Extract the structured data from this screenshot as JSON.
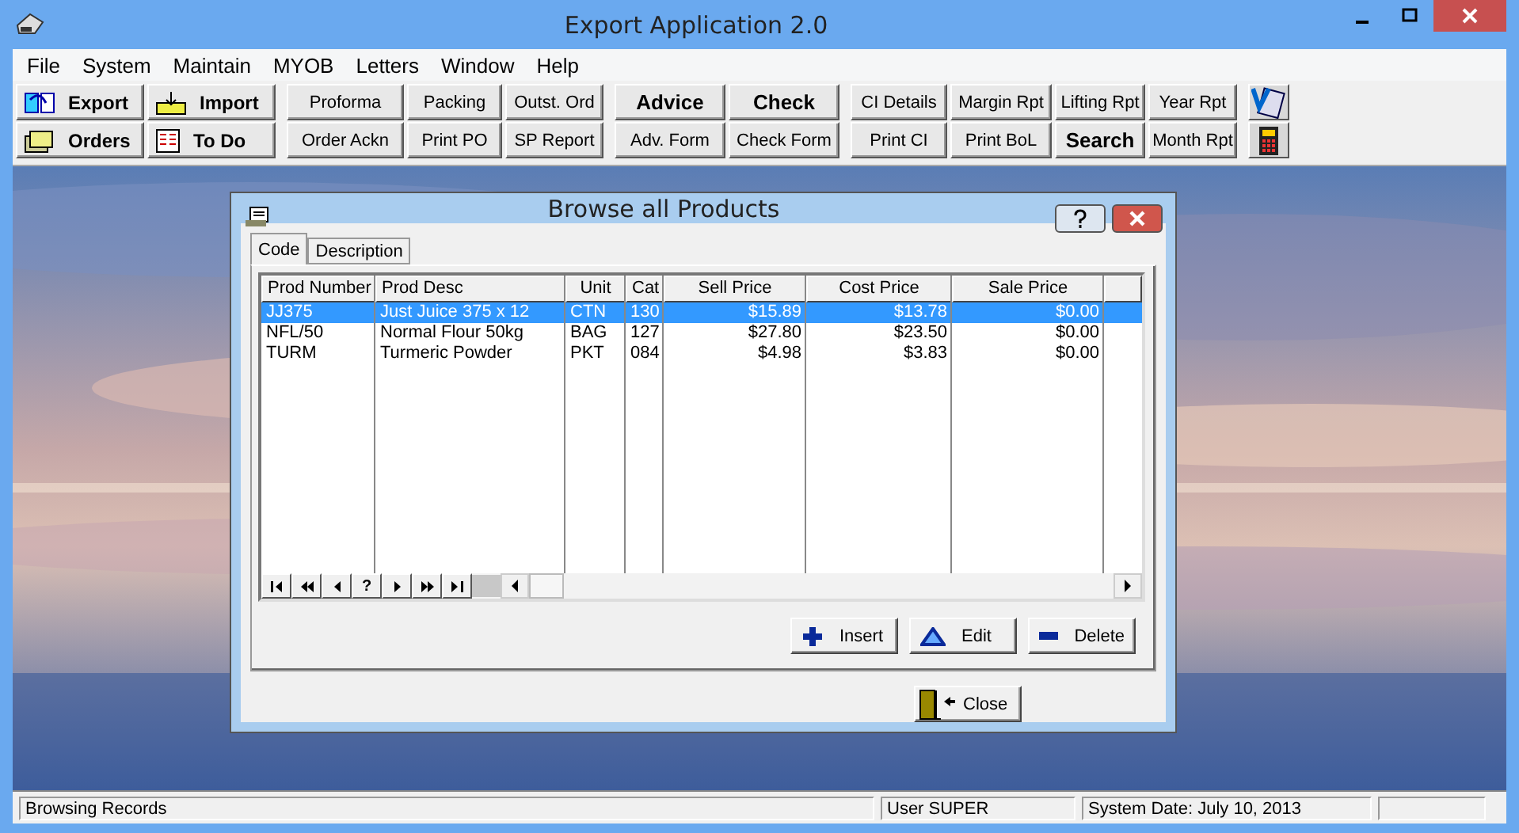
{
  "window": {
    "title": "Export  Application  2.0"
  },
  "menu": [
    "File",
    "System",
    "Maintain",
    "MYOB",
    "Letters",
    "Window",
    "Help"
  ],
  "toolbar": {
    "groups": [
      {
        "kind": "icon",
        "buttons": [
          {
            "label": "Export"
          },
          {
            "label": "Orders"
          }
        ]
      },
      {
        "kind": "icon",
        "buttons": [
          {
            "label": "Import"
          },
          {
            "label": "To Do"
          }
        ]
      },
      {
        "kind": "plain",
        "buttons": [
          {
            "label": "Proforma",
            "bold": false
          },
          {
            "label": "Order Ackn",
            "bold": false
          }
        ]
      },
      {
        "kind": "plain",
        "buttons": [
          {
            "label": "Packing",
            "bold": false
          },
          {
            "label": "Print PO",
            "bold": false
          }
        ]
      },
      {
        "kind": "plain",
        "buttons": [
          {
            "label": "Outst. Ord",
            "bold": false
          },
          {
            "label": "SP Report",
            "bold": false
          }
        ]
      },
      {
        "kind": "plain",
        "buttons": [
          {
            "label": "Advice",
            "bold": true
          },
          {
            "label": "Adv. Form",
            "bold": false
          }
        ]
      },
      {
        "kind": "plain",
        "buttons": [
          {
            "label": "Check",
            "bold": true
          },
          {
            "label": "Check Form",
            "bold": false
          }
        ]
      },
      {
        "kind": "plain",
        "buttons": [
          {
            "label": "CI Details",
            "bold": false
          },
          {
            "label": "Print CI",
            "bold": false
          }
        ]
      },
      {
        "kind": "plain",
        "buttons": [
          {
            "label": "Margin Rpt",
            "bold": false
          },
          {
            "label": "Print BoL",
            "bold": false
          }
        ]
      },
      {
        "kind": "plain",
        "buttons": [
          {
            "label": "Lifting Rpt",
            "bold": false
          },
          {
            "label": "Search",
            "bold": true
          }
        ]
      },
      {
        "kind": "plain",
        "buttons": [
          {
            "label": "Year Rpt",
            "bold": false
          },
          {
            "label": "Month Rpt",
            "bold": false
          }
        ]
      },
      {
        "kind": "tools"
      }
    ]
  },
  "dialog": {
    "title": "Browse all Products",
    "tabs": [
      {
        "label": "Code",
        "selected": true
      },
      {
        "label": "Description",
        "selected": false
      }
    ],
    "table": {
      "columns": [
        "Prod Number",
        "Prod Desc",
        "Unit",
        "Cat",
        "Sell Price",
        "Cost Price",
        "Sale Price"
      ],
      "rows": [
        {
          "selected": true,
          "cells": [
            "JJ375",
            "Just Juice 375 x 12",
            "CTN",
            "130",
            "$15.89",
            "$13.78",
            "$0.00"
          ]
        },
        {
          "selected": false,
          "cells": [
            "NFL/50",
            "Normal Flour 50kg",
            "BAG",
            "127",
            "$27.80",
            "$23.50",
            "$0.00"
          ]
        },
        {
          "selected": false,
          "cells": [
            "TURM",
            "Turmeric Powder",
            "PKT",
            "084",
            "$4.98",
            "$3.83",
            "$0.00"
          ]
        }
      ]
    },
    "navigator": [
      {
        "kind": "first"
      },
      {
        "kind": "prior-page"
      },
      {
        "kind": "prior"
      },
      {
        "kind": "label",
        "label": "?"
      },
      {
        "kind": "next"
      },
      {
        "kind": "next-page"
      },
      {
        "kind": "last"
      }
    ],
    "actions": [
      {
        "label": "Insert",
        "kind": "insert"
      },
      {
        "label": "Edit",
        "kind": "edit"
      },
      {
        "label": "Delete",
        "kind": "delete"
      }
    ],
    "close": "Close"
  },
  "status_bar": [
    "Browsing Records",
    "User SUPER",
    "System Date: July 10, 2013"
  ]
}
